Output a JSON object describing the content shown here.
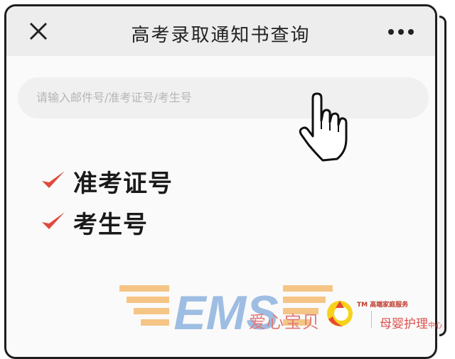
{
  "navbar": {
    "title": "高考录取通知书查询",
    "close_icon": "close-icon",
    "more_icon": "more-icon"
  },
  "search": {
    "placeholder": "请输入邮件号/准考证号/考生号"
  },
  "checklist": [
    {
      "label": "准考证号",
      "icon": "checkmark-icon"
    },
    {
      "label": "考生号",
      "icon": "checkmark-icon"
    }
  ],
  "watermark": {
    "ems_logo": "EMS",
    "brand": "爱心宝贝",
    "tm": "TM 高端家庭服务",
    "slogan": "母婴护理",
    "slogan_suffix": "中心"
  },
  "colors": {
    "navbar_bg": "#ededed",
    "check": "#e04a3c",
    "ems": "#f5c07a",
    "ems_blue": "#8fb3e0"
  }
}
